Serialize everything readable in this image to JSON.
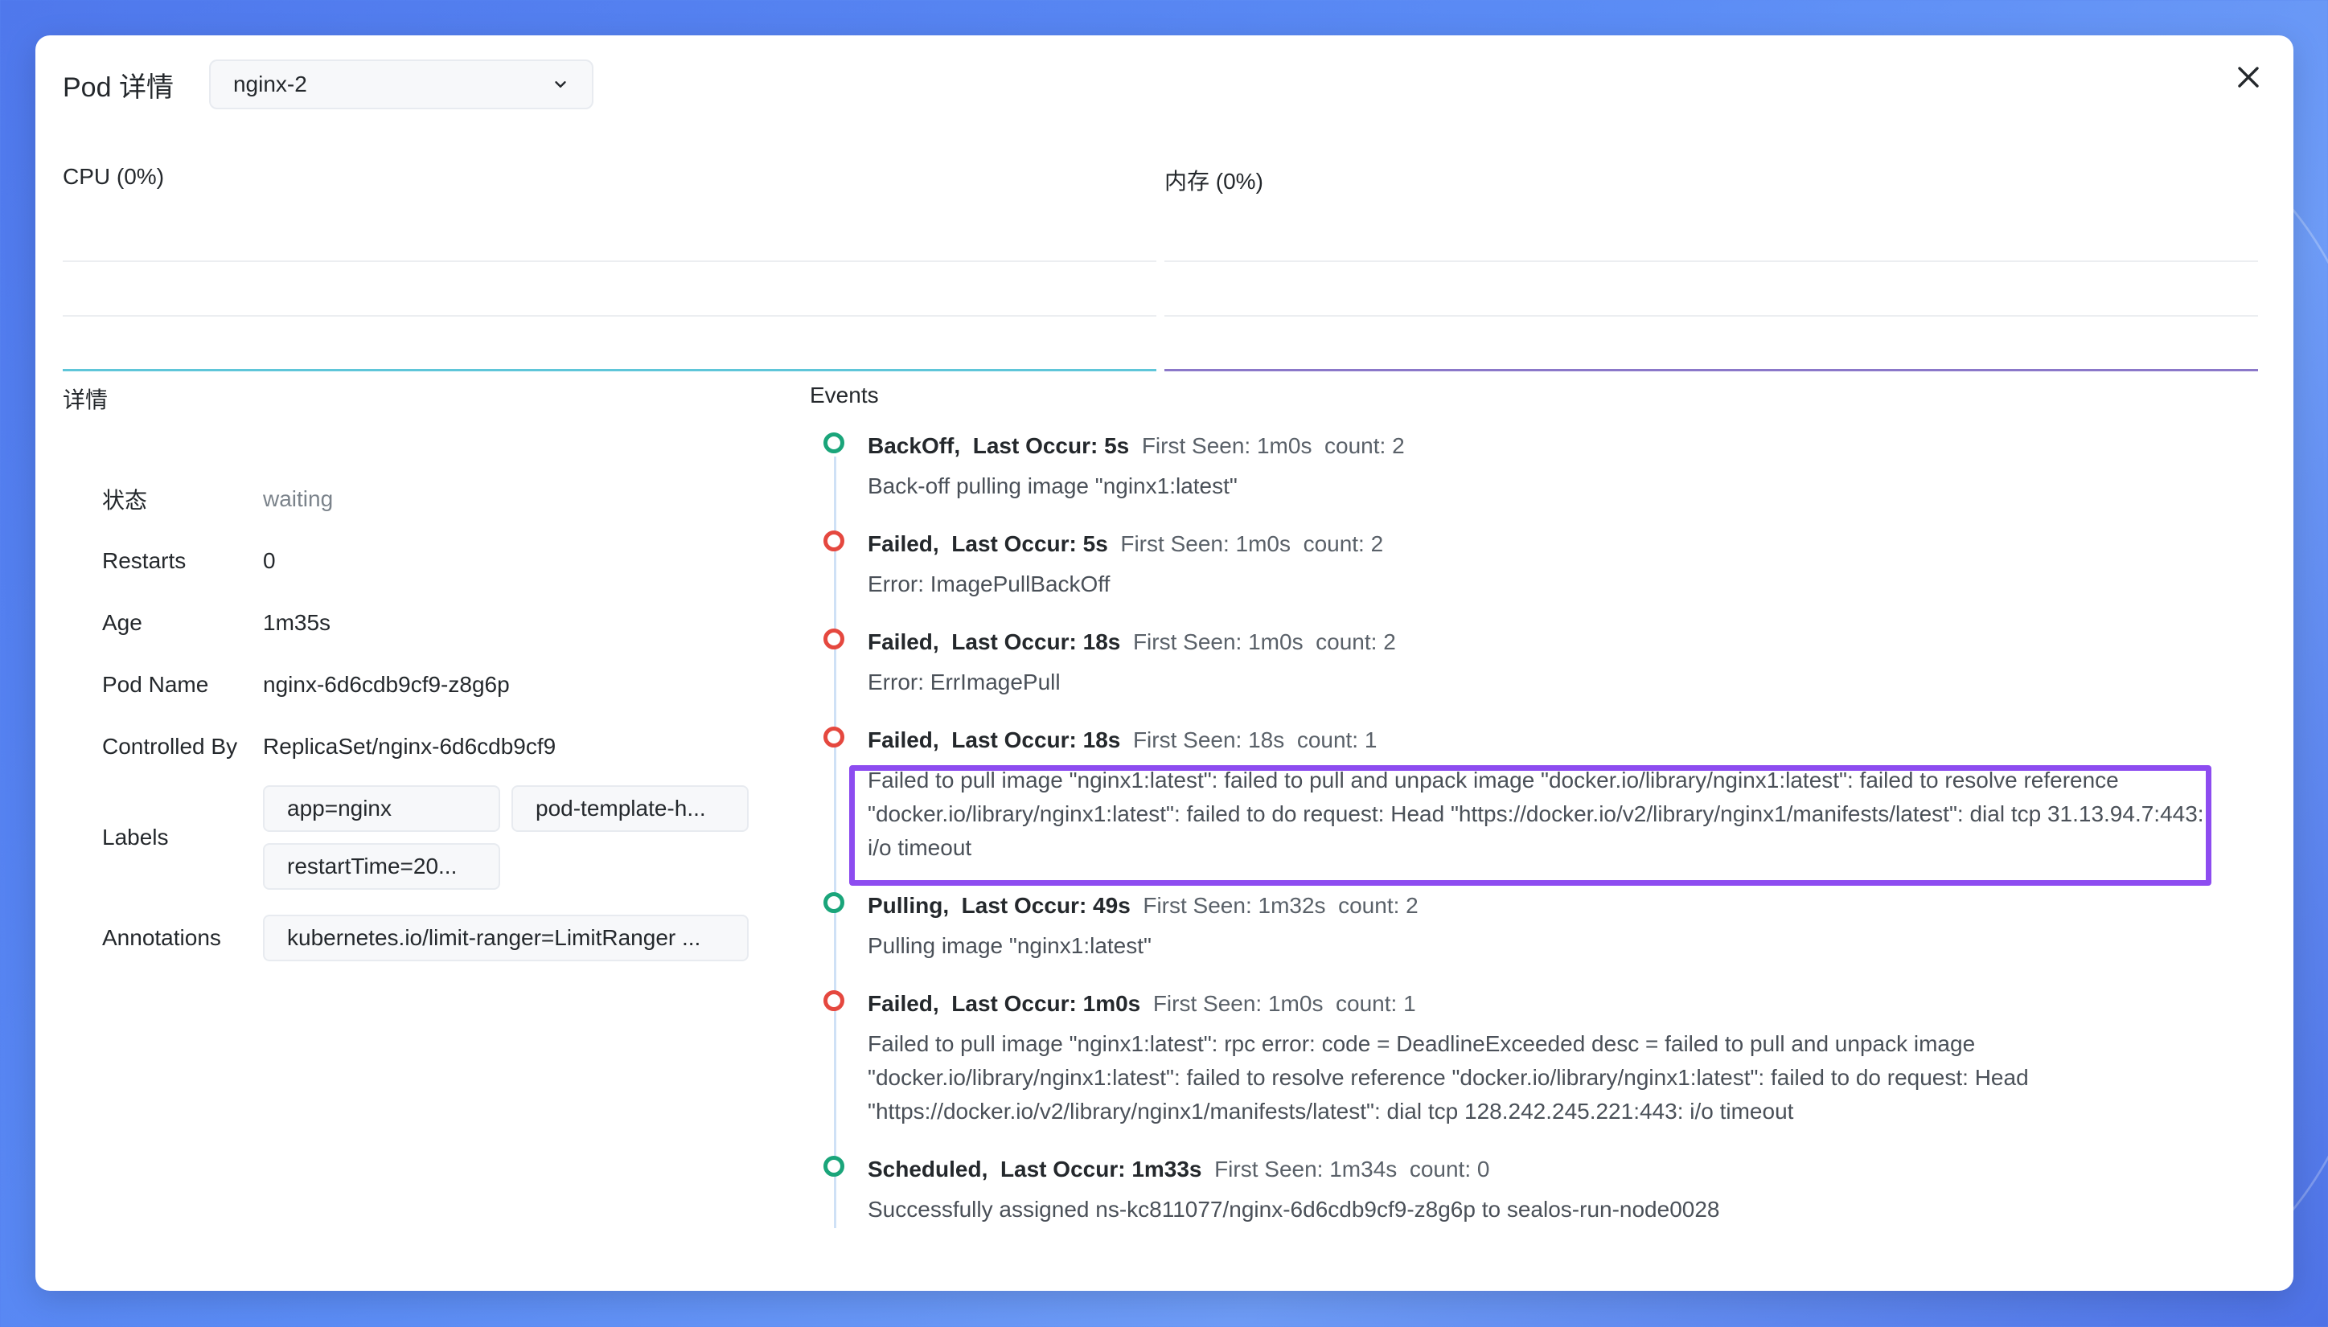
{
  "header": {
    "title": "Pod 详情",
    "pod_selected": "nginx-2"
  },
  "charts": {
    "cpu_label": "CPU (0%)",
    "memory_label": "内存 (0%)",
    "cpu_color": "#5fc6d9",
    "memory_color": "#8b78c9"
  },
  "details": {
    "title": "详情",
    "status_label": "状态",
    "status_value": "waiting",
    "restarts_label": "Restarts",
    "restarts_value": "0",
    "age_label": "Age",
    "age_value": "1m35s",
    "podname_label": "Pod Name",
    "podname_value": "nginx-6d6cdb9cf9-z8g6p",
    "controlled_label": "Controlled By",
    "controlled_value": "ReplicaSet/nginx-6d6cdb9cf9",
    "labels_label": "Labels",
    "labels": [
      "app=nginx",
      "pod-template-h...",
      "restartTime=20..."
    ],
    "annotations_label": "Annotations",
    "annotations": [
      "kubernetes.io/limit-ranger=LimitRanger ..."
    ]
  },
  "events": {
    "title": "Events",
    "items": [
      {
        "reason": "BackOff,",
        "last": "Last Occur: 5s",
        "first": "First Seen: 1m0s",
        "count": "count: 2",
        "message": "Back-off pulling image \"nginx1:latest\"",
        "status": "normal"
      },
      {
        "reason": "Failed,",
        "last": "Last Occur: 5s",
        "first": "First Seen: 1m0s",
        "count": "count: 2",
        "message": "Error: ImagePullBackOff",
        "status": "fail"
      },
      {
        "reason": "Failed,",
        "last": "Last Occur: 18s",
        "first": "First Seen: 1m0s",
        "count": "count: 2",
        "message": "Error: ErrImagePull",
        "status": "fail"
      },
      {
        "reason": "Failed,",
        "last": "Last Occur: 18s",
        "first": "First Seen: 18s",
        "count": "count: 1",
        "message": "Failed to pull image \"nginx1:latest\": failed to pull and unpack image \"docker.io/library/nginx1:latest\": failed to resolve reference \"docker.io/library/nginx1:latest\": failed to do request: Head \"https://docker.io/v2/library/nginx1/manifests/latest\": dial tcp 31.13.94.7:443: i/o timeout",
        "status": "fail"
      },
      {
        "reason": "Pulling,",
        "last": "Last Occur: 49s",
        "first": "First Seen: 1m32s",
        "count": "count: 2",
        "message": "Pulling image \"nginx1:latest\"",
        "status": "normal"
      },
      {
        "reason": "Failed,",
        "last": "Last Occur: 1m0s",
        "first": "First Seen: 1m0s",
        "count": "count: 1",
        "message": "Failed to pull image \"nginx1:latest\": rpc error: code = DeadlineExceeded desc = failed to pull and unpack image \"docker.io/library/nginx1:latest\": failed to resolve reference \"docker.io/library/nginx1:latest\": failed to do request: Head \"https://docker.io/v2/library/nginx1/manifests/latest\": dial tcp 128.242.245.221:443: i/o timeout",
        "status": "fail"
      },
      {
        "reason": "Scheduled,",
        "last": "Last Occur: 1m33s",
        "first": "First Seen: 1m34s",
        "count": "count: 0",
        "message": "Successfully assigned ns-kc811077/nginx-6d6cdb9cf9-z8g6p to sealos-run-node0028",
        "status": "normal"
      }
    ]
  },
  "colors": {
    "success": "#1aa57a",
    "failure": "#e5483f",
    "highlight": "#8d4cf0"
  }
}
